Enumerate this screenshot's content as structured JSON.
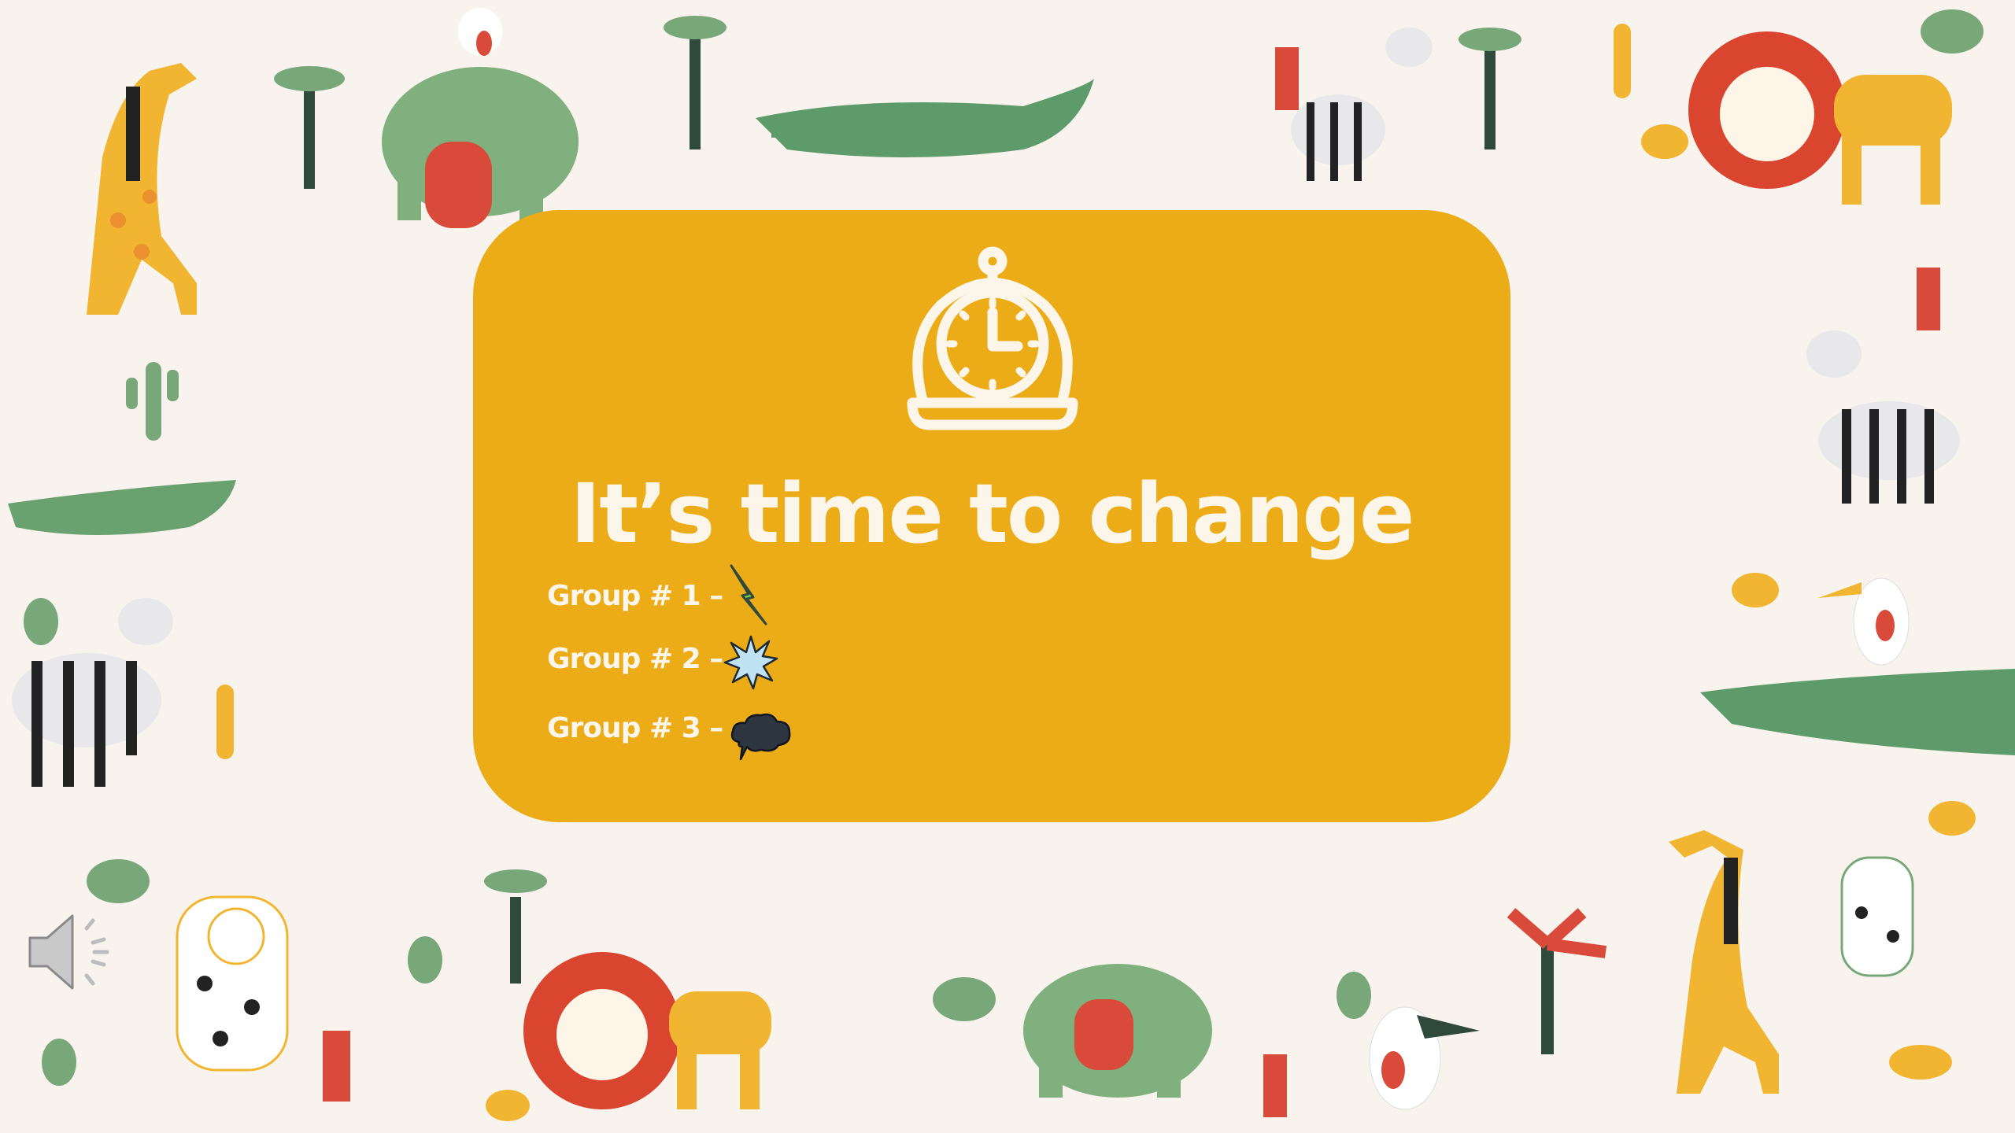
{
  "slide": {
    "title": "It’s time to change",
    "groups": [
      {
        "label": "Group # 1 –",
        "icon": "lightning-bolt-icon"
      },
      {
        "label": "Group # 2 –",
        "icon": "starburst-icon"
      },
      {
        "label": "Group # 3 –",
        "icon": "dark-cloud-icon"
      }
    ],
    "timer_icon": "stopwatch-icon",
    "audio_icon": "speaker-icon"
  },
  "colors": {
    "background": "#f8f3ec",
    "card": "#ecac17",
    "text": "#fbf5ea",
    "green": "#78a77a",
    "red": "#d94a3a",
    "yellow": "#f2b531"
  }
}
